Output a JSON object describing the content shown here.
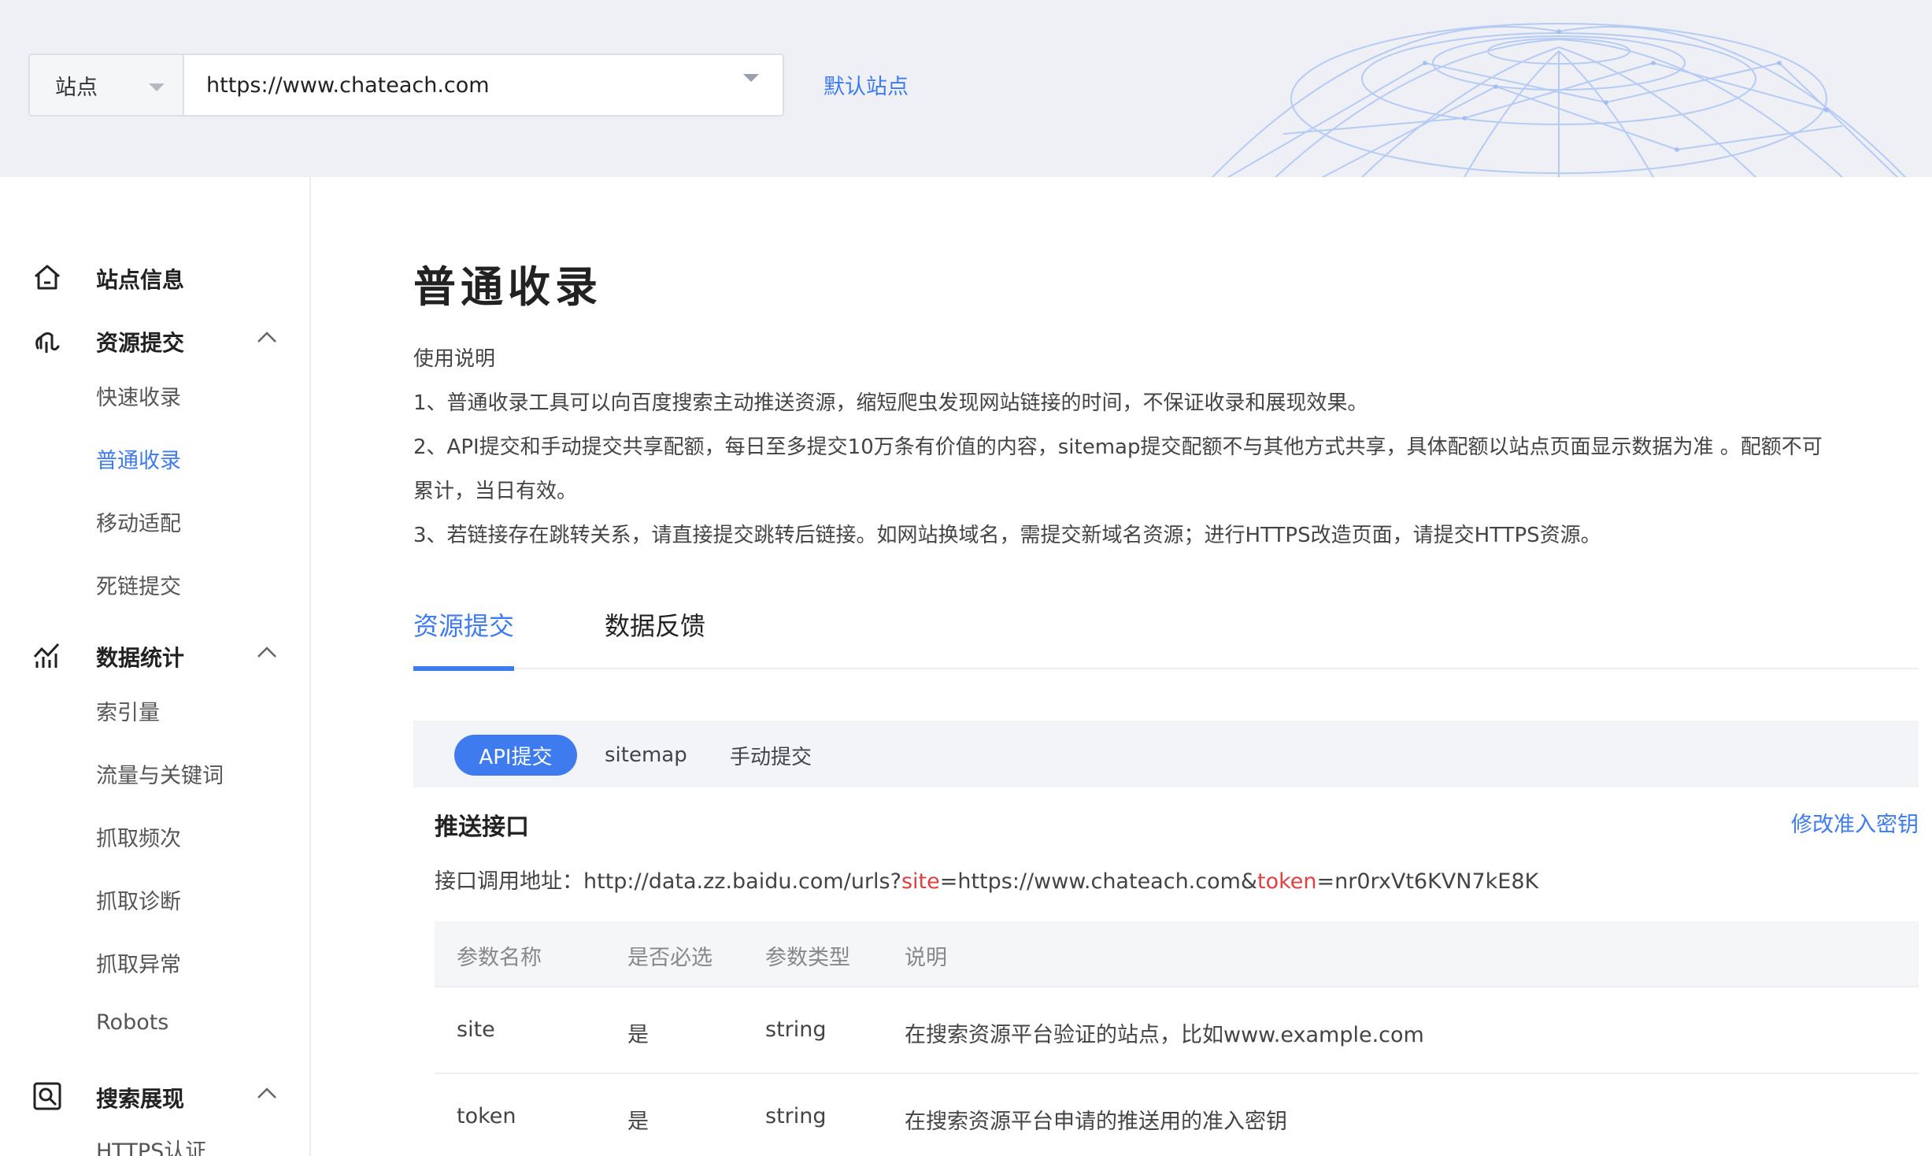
{
  "header": {
    "site_label": "站点",
    "site_url": "https://www.chateach.com",
    "default_site_link": "默认站点"
  },
  "sidebar": {
    "groups": [
      {
        "label": "站点信息",
        "icon": "home-icon",
        "expanded": false,
        "items": []
      },
      {
        "label": "资源提交",
        "icon": "resource-submit-icon",
        "expanded": true,
        "items": [
          "快速收录",
          "普通收录",
          "移动适配",
          "死链提交"
        ]
      },
      {
        "label": "数据统计",
        "icon": "stats-icon",
        "expanded": true,
        "items": [
          "索引量",
          "流量与关键词",
          "抓取频次",
          "抓取诊断",
          "抓取异常",
          "Robots"
        ]
      },
      {
        "label": "搜索展现",
        "icon": "search-display-icon",
        "expanded": true,
        "items": [
          "HTTPS认证"
        ]
      }
    ],
    "active_item": "普通收录"
  },
  "main": {
    "title": "普通收录",
    "usage_heading": "使用说明",
    "usage_lines": [
      "1、普通收录工具可以向百度搜索主动推送资源，缩短爬虫发现网站链接的时间，不保证收录和展现效果。",
      "2、API提交和手动提交共享配额，每日至多提交10万条有价值的内容，sitemap提交配额不与其他方式共享，具体配额以站点页面显示数据为准 。配额不可",
      "累计，当日有效。",
      "3、若链接存在跳转关系，请直接提交跳转后链接。如网站换域名，需提交新域名资源；进行HTTPS改造页面，请提交HTTPS资源。"
    ],
    "tabs": [
      {
        "label": "资源提交",
        "active": true
      },
      {
        "label": "数据反馈",
        "active": false
      }
    ],
    "sub_tabs": [
      {
        "label": "API提交",
        "active": true
      },
      {
        "label": "sitemap",
        "active": false
      },
      {
        "label": "手动提交",
        "active": false
      }
    ],
    "push_section": {
      "title": "推送接口",
      "modify_key_link": "修改准入密钥",
      "url_prefix": "接口调用地址：http://data.zz.baidu.com/urls?",
      "param_site": "site",
      "site_value": "=https://www.chateach.com&",
      "param_token": "token",
      "token_value": "=nr0rxVt6KVN7kE8K"
    },
    "param_table": {
      "headers": [
        "参数名称",
        "是否必选",
        "参数类型",
        "说明"
      ],
      "rows": [
        [
          "site",
          "是",
          "string",
          "在搜索资源平台验证的站点，比如www.example.com"
        ],
        [
          "token",
          "是",
          "string",
          "在搜索资源平台申请的推送用的准入密钥"
        ]
      ]
    }
  },
  "colors": {
    "accent": "#3e7bef",
    "highlight": "#e0413f",
    "header_bg": "#eef0f6"
  }
}
